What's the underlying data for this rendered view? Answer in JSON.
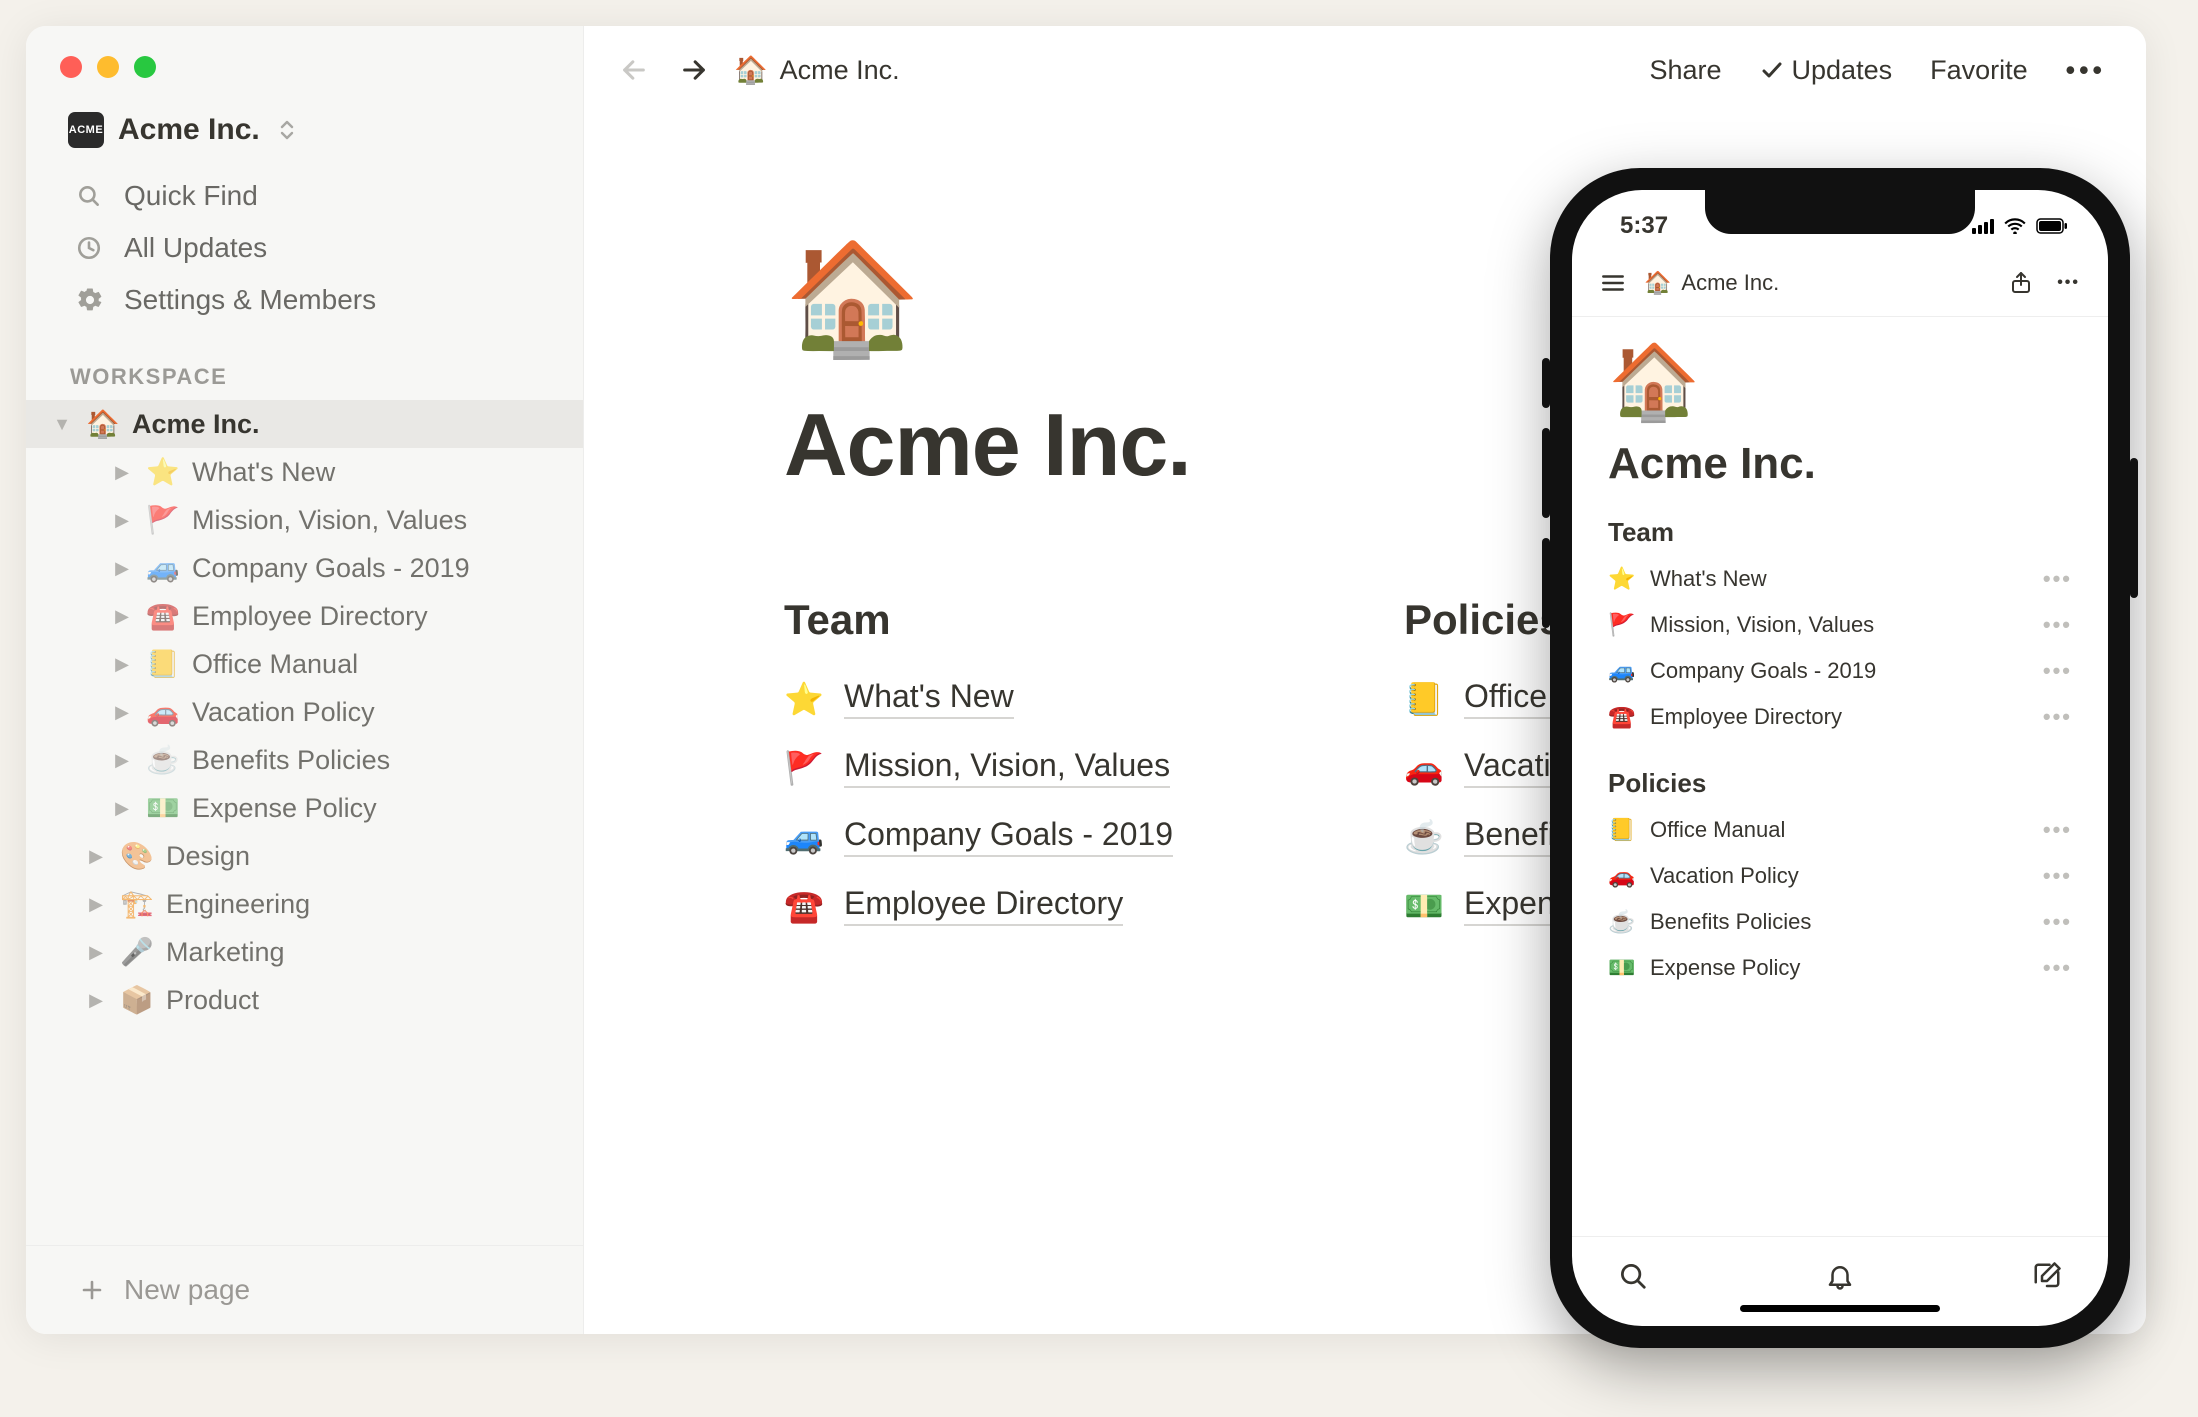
{
  "workspace": {
    "name": "Acme Inc.",
    "icon_text": "ACME"
  },
  "sidebar": {
    "quick_find": "Quick Find",
    "all_updates": "All Updates",
    "settings_members": "Settings & Members",
    "section_label": "WORKSPACE",
    "new_page": "New page",
    "tree": [
      {
        "emoji": "🏠",
        "label": "Acme Inc.",
        "depth": 0,
        "selected": true,
        "open": true
      },
      {
        "emoji": "⭐",
        "label": "What's New",
        "depth": 1
      },
      {
        "emoji": "🚩",
        "label": "Mission, Vision, Values",
        "depth": 1
      },
      {
        "emoji": "🚙",
        "label": "Company Goals - 2019",
        "depth": 1
      },
      {
        "emoji": "☎️",
        "label": "Employee Directory",
        "depth": 1
      },
      {
        "emoji": "📒",
        "label": "Office Manual",
        "depth": 1
      },
      {
        "emoji": "🚗",
        "label": "Vacation Policy",
        "depth": 1
      },
      {
        "emoji": "☕",
        "label": "Benefits Policies",
        "depth": 1
      },
      {
        "emoji": "💵",
        "label": "Expense Policy",
        "depth": 1
      },
      {
        "emoji": "🎨",
        "label": "Design",
        "depth": 0
      },
      {
        "emoji": "🏗️",
        "label": "Engineering",
        "depth": 0
      },
      {
        "emoji": "🎤",
        "label": "Marketing",
        "depth": 0
      },
      {
        "emoji": "📦",
        "label": "Product",
        "depth": 0
      }
    ]
  },
  "topbar": {
    "breadcrumb_emoji": "🏠",
    "breadcrumb_label": "Acme Inc.",
    "share": "Share",
    "updates": "Updates",
    "favorite": "Favorite"
  },
  "page": {
    "icon": "🏠",
    "title": "Acme Inc.",
    "columns": [
      {
        "heading": "Team",
        "links": [
          {
            "emoji": "⭐",
            "label": "What's New"
          },
          {
            "emoji": "🚩",
            "label": "Mission, Vision, Values"
          },
          {
            "emoji": "🚙",
            "label": "Company Goals - 2019"
          },
          {
            "emoji": "☎️",
            "label": "Employee Directory"
          }
        ]
      },
      {
        "heading": "Policies",
        "links": [
          {
            "emoji": "📒",
            "label": "Office Manual"
          },
          {
            "emoji": "🚗",
            "label": "Vacation Policy"
          },
          {
            "emoji": "☕",
            "label": "Benefits Policies"
          },
          {
            "emoji": "💵",
            "label": "Expense Policy"
          }
        ]
      }
    ]
  },
  "mobile": {
    "time": "5:37",
    "breadcrumb_emoji": "🏠",
    "breadcrumb_label": "Acme Inc.",
    "page_icon": "🏠",
    "page_title": "Acme Inc.",
    "sections": [
      {
        "heading": "Team",
        "links": [
          {
            "emoji": "⭐",
            "label": "What's New"
          },
          {
            "emoji": "🚩",
            "label": "Mission, Vision, Values"
          },
          {
            "emoji": "🚙",
            "label": "Company Goals - 2019"
          },
          {
            "emoji": "☎️",
            "label": "Employee Directory"
          }
        ]
      },
      {
        "heading": "Policies",
        "links": [
          {
            "emoji": "📒",
            "label": "Office Manual"
          },
          {
            "emoji": "🚗",
            "label": "Vacation Policy"
          },
          {
            "emoji": "☕",
            "label": "Benefits Policies"
          },
          {
            "emoji": "💵",
            "label": "Expense Policy"
          }
        ]
      }
    ]
  }
}
